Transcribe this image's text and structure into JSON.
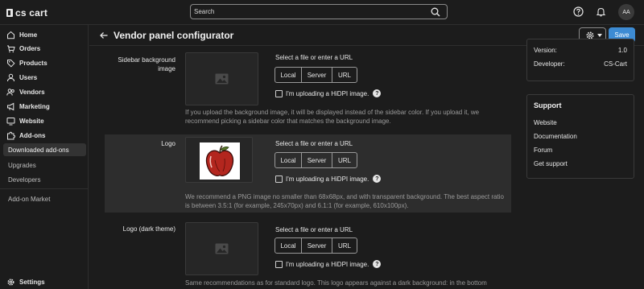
{
  "app": {
    "brand": "cs cart"
  },
  "search": {
    "placeholder": "Search"
  },
  "user": {
    "initials": "AA"
  },
  "sidebar": {
    "items": [
      {
        "label": "Home",
        "icon": "home-icon"
      },
      {
        "label": "Orders",
        "icon": "cart-icon"
      },
      {
        "label": "Products",
        "icon": "tag-icon"
      },
      {
        "label": "Users",
        "icon": "users-icon"
      },
      {
        "label": "Vendors",
        "icon": "vendors-icon"
      },
      {
        "label": "Marketing",
        "icon": "megaphone-icon"
      },
      {
        "label": "Website",
        "icon": "monitor-icon"
      },
      {
        "label": "Add-ons",
        "icon": "puzzle-icon"
      }
    ],
    "subitems": [
      {
        "label": "Downloaded add-ons",
        "active": true
      },
      {
        "label": "Upgrades"
      },
      {
        "label": "Developers"
      }
    ],
    "market": "Add-on Market",
    "settings": "Settings"
  },
  "page": {
    "title": "Vendor panel configurator",
    "save_label": "Save"
  },
  "fields": [
    {
      "label": "Sidebar background image",
      "select_label": "Select a file or enter a URL",
      "buttons": [
        "Local",
        "Server",
        "URL"
      ],
      "hidpi": "I'm uploading a HiDPI image.",
      "note": "If you upload the background image, it will be displayed instead of the sidebar color. If you upload it, we recommend picking a sidebar color that matches the background image."
    },
    {
      "label": "Logo",
      "select_label": "Select a file or enter a URL",
      "buttons": [
        "Local",
        "Server",
        "URL"
      ],
      "hidpi": "I'm uploading a HiDPI image.",
      "note": "We recommend a PNG image no smaller than 68x68px, and with transparent background. The best aspect ratio is between 3.5:1 (for example, 245x70px) and 6.1:1 (for example, 610x100px)."
    },
    {
      "label": "Logo (dark theme)",
      "select_label": "Select a file or enter a URL",
      "buttons": [
        "Local",
        "Server",
        "URL"
      ],
      "hidpi": "I'm uploading a HiDPI image.",
      "note": "Same recommendations as for standard logo. This logo appears against a dark background: in the bottom"
    }
  ],
  "info_panel": {
    "version_label": "Version:",
    "version": "1.0",
    "developer_label": "Developer:",
    "developer": "CS-Cart"
  },
  "support": {
    "title": "Support",
    "links": [
      "Website",
      "Documentation",
      "Forum",
      "Get support"
    ]
  }
}
